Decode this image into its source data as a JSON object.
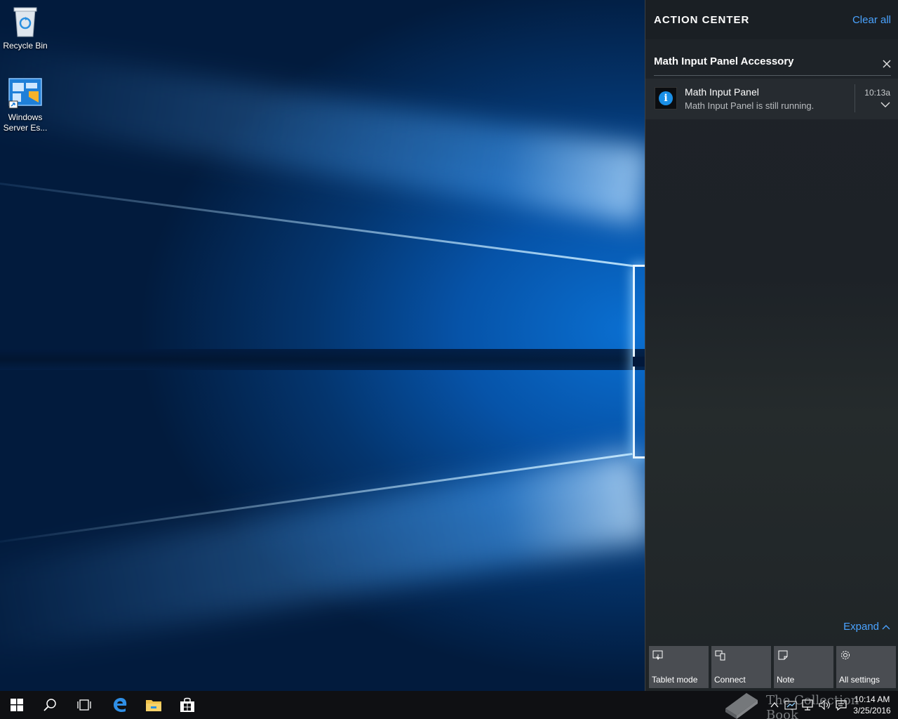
{
  "desktop": {
    "icons": [
      {
        "label": "Recycle Bin",
        "icon": "recycle-bin-icon"
      },
      {
        "label": "Windows Server Es...",
        "icon": "windows-server-essentials-icon"
      }
    ]
  },
  "action_center": {
    "title": "ACTION CENTER",
    "clear_all": "Clear all",
    "group": {
      "title": "Math Input Panel Accessory",
      "close_icon": "close-icon",
      "notification": {
        "icon": "info-icon",
        "title": "Math Input Panel",
        "body": "Math Input Panel is still running.",
        "time": "10:13a",
        "expand_icon": "chevron-down-icon"
      }
    },
    "expand": "Expand",
    "quick_actions": [
      {
        "label": "Tablet mode",
        "icon": "tablet-mode-icon"
      },
      {
        "label": "Connect",
        "icon": "connect-icon"
      },
      {
        "label": "Note",
        "icon": "note-icon"
      },
      {
        "label": "All settings",
        "icon": "gear-icon"
      }
    ]
  },
  "taskbar": {
    "clock": {
      "time": "10:14 AM",
      "date": "3/25/2016"
    },
    "watermark": "The Collection Book"
  }
}
